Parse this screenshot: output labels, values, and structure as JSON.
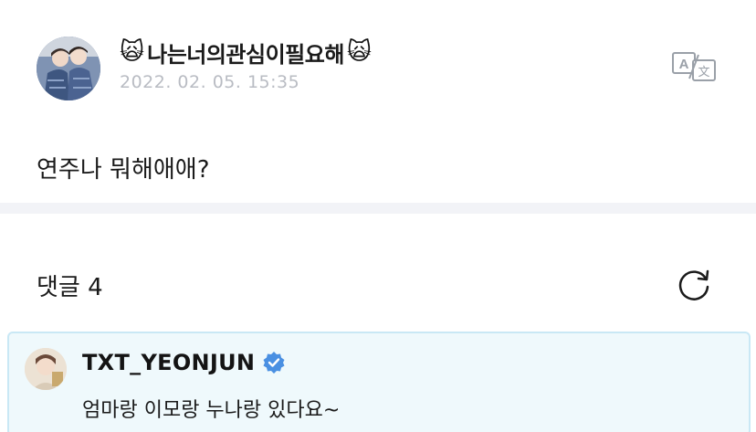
{
  "post": {
    "author_emoji_left": "🙀",
    "author_name": "나는너의관심이필요해",
    "author_emoji_right": "🙀",
    "timestamp": "2022. 02. 05. 15:35",
    "body": "연주나 뭐해애애?",
    "translate_icon": "translate-icon"
  },
  "comments": {
    "header": "댓글 4",
    "refresh_icon": "refresh-icon",
    "items": [
      {
        "author": "TXT_YEONJUN",
        "verified": true,
        "text": "엄마랑 이모랑 누나랑 있다요~"
      }
    ]
  },
  "colors": {
    "verified_badge": "#4a90e2",
    "comment_bg": "#eff9fc",
    "comment_border": "#c9e8f5",
    "timestamp": "#b9bcc3",
    "divider": "#f2f3f7"
  }
}
